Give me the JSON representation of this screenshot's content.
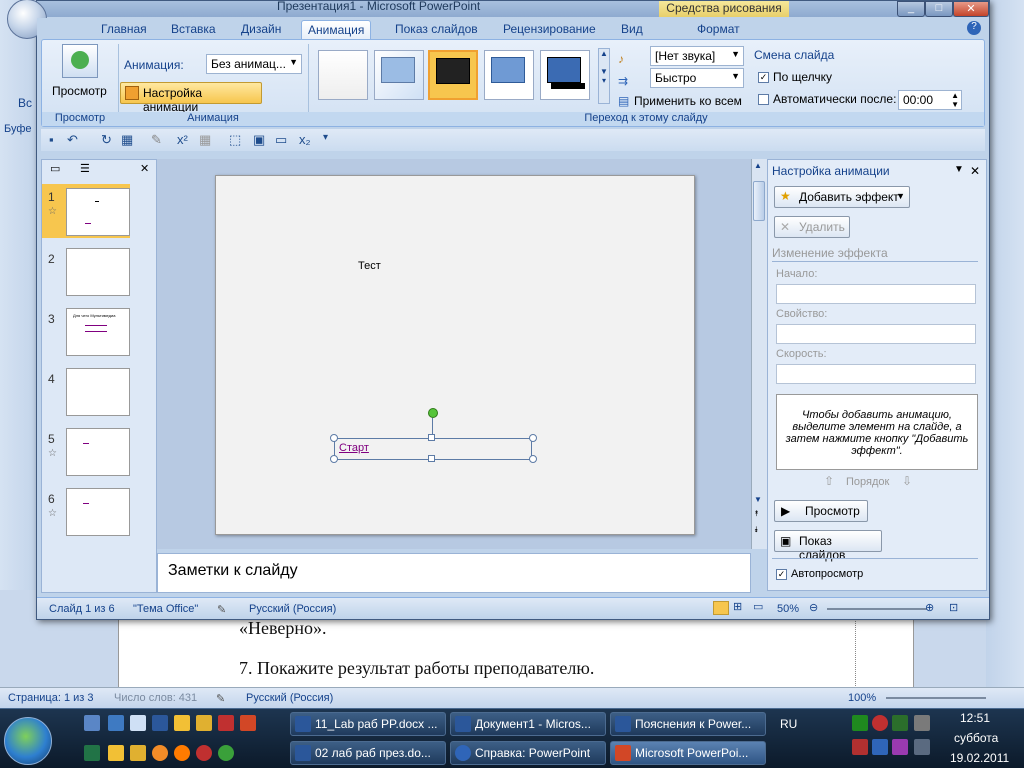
{
  "word": {
    "doc_line1": "«Неверно».",
    "doc_line2": "7. Покажите  результат работы преподавателю.",
    "status_page": "Страница: 1 из 3",
    "status_words": "Число слов: 431",
    "status_lang": "Русский (Россия)",
    "status_zoom": "100%",
    "left_ribbon_label": "Вс",
    "left_group_label": "Буфе"
  },
  "ppt": {
    "title": "Презентация1 - Microsoft PowerPoint",
    "tools_tab": "Средства рисования",
    "tabs": [
      "Главная",
      "Вставка",
      "Дизайн",
      "Анимация",
      "Показ слайдов",
      "Рецензирование",
      "Вид",
      "Формат"
    ],
    "active_tab": "Анимация",
    "ribbon": {
      "preview_label": "Просмотр",
      "preview_group": "Просмотр",
      "animation_label": "Анимация:",
      "animation_value": "Без анимац...",
      "custom_animation": "Настройка анимации",
      "animation_group": "Анимация",
      "sound_value": "[Нет звука]",
      "speed_value": "Быстро",
      "apply_all": "Применить ко всем",
      "transition_title": "Смена слайда",
      "on_click": "По щелчку",
      "auto_after": "Автоматически после:",
      "auto_time": "00:00",
      "transition_group": "Переход к этому слайду"
    },
    "slides": [
      {
        "num": "1",
        "star": "☆"
      },
      {
        "num": "2",
        "star": ""
      },
      {
        "num": "3",
        "star": ""
      },
      {
        "num": "4",
        "star": ""
      },
      {
        "num": "5",
        "star": "☆"
      },
      {
        "num": "6",
        "star": "☆"
      }
    ],
    "thumb3_title": "Для чего Мультимедиа",
    "slide_text_test": "Тест",
    "slide_text_start": "Старт",
    "notes_placeholder": "Заметки к слайду",
    "task_pane": {
      "title": "Настройка анимации",
      "add_effect": "Добавить эффект",
      "remove": "Удалить",
      "change_effect": "Изменение эффекта",
      "start_label": "Начало:",
      "property_label": "Свойство:",
      "speed_label": "Скорость:",
      "hint": "Чтобы добавить анимацию, выделите элемент на слайде, а затем нажмите кнопку \"Добавить эффект\".",
      "order": "Порядок",
      "preview": "Просмотр",
      "slideshow": "Показ слайдов",
      "autopreview": "Автопросмотр"
    },
    "status": {
      "slide_info": "Слайд 1 из 6",
      "theme": "\"Тема Office\"",
      "lang": "Русский (Россия)",
      "zoom": "50%"
    }
  },
  "taskbar": {
    "buttons_row1": [
      "11_Lab раб PP.docx ...",
      "Документ1 - Micros...",
      "Пояснения к Power..."
    ],
    "buttons_row2": [
      "02 лаб раб през.do...",
      "Справка: PowerPoint",
      "Microsoft PowerPoi..."
    ],
    "lang": "RU",
    "time": "12:51",
    "day": "суббота",
    "date": "19.02.2011"
  },
  "colors": {
    "accent": "#15428b",
    "active_orange": "#f7c64e"
  }
}
